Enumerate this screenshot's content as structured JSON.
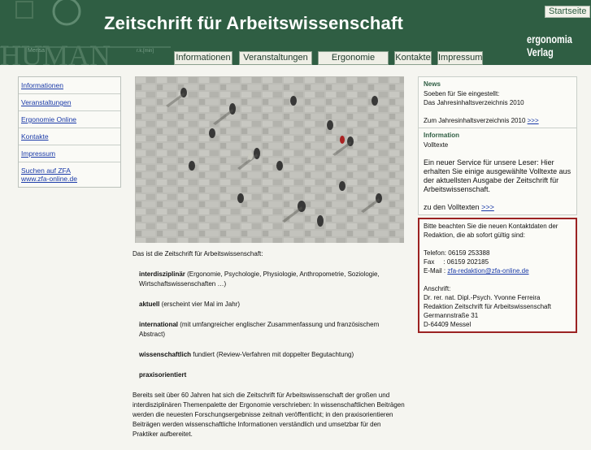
{
  "header": {
    "title": "Zeitschrift für Arbeitswissenschaft",
    "startseite": "Startseite",
    "brand_line1": "ergonomia",
    "brand_line2": "Verlag",
    "logo_text": "HUMAN",
    "logo_small1": "Mensa",
    "logo_small2": "r.k.[min]",
    "tabs": [
      "Informationen",
      "Veranstaltungen",
      "Ergonomie Online",
      "Kontakte",
      "Impressum"
    ],
    "bg_color": "#2f5e43"
  },
  "nav": {
    "items": [
      "Informationen",
      "Veranstaltungen",
      "Ergonomie Online",
      "Kontakte",
      "Impressum"
    ],
    "search_line1": "Suchen auf ZFA",
    "search_line2": "www.zfa-online.de"
  },
  "intro": {
    "lead": "Das ist die Zeitschrift für Arbeitswissenschaft:",
    "f1_bold": "interdisziplinär",
    "f1_text": " (Ergonomie, Psychologie, Physiologie, Anthropometrie, Soziologie, Wirtschaftswissenschaften …)",
    "f2_bold": "aktuell",
    "f2_text": " (erscheint vier Mal im Jahr)",
    "f3_bold": "international",
    "f3_text": " (mit umfangreicher englischer Zusammenfassung und französischem Abstract)",
    "f4_bold": "wissenschaftlich",
    "f4_text": " fundiert (Review-Verfahren mit doppelter Begutachtung)",
    "f5_bold": "praxisorientiert",
    "closing": "Bereits seit über 60 Jahren hat sich die Zeitschrift für Arbeitswissenschaft der großen und interdisziplinären Themenpalette der Ergonomie verschrieben: In wissenschaftlichen Beiträgen werden die neuesten Forschungsergebnisse zeitnah veröffentlicht; in den praxisorientieren Beiträgen werden wissenschaftliche Informationen verständlich und umsetzbar für den Praktiker aufbereitet."
  },
  "sidebar": {
    "news_head": "News",
    "news_l1": "Soeben für Sie eingestellt:",
    "news_l2": "Das Jahresinhaltsverzeichnis 2010",
    "news_link_text": "Zum Jahresinhaltsverzeichnis 2010 ",
    "news_link_arrow": ">>>",
    "info_head": "Information",
    "info_l1": "Volltexte",
    "info_body": "Ein neuer Service für unsere Leser: Hier erhalten Sie einige ausgewählte Volltexte aus der aktuellsten Ausgabe der Zeitschrift für Arbeitswissenschaft.",
    "info_link_text": "zu den Volltexten ",
    "info_link_arrow": ">>>"
  },
  "contact": {
    "intro": "Bitte beachten Sie die neuen Kontaktdaten der Redaktion, die ab sofort gültig sind:",
    "telefon": "Telefon: 06159 253388",
    "fax": "Fax     : 06159 202185",
    "email_label": "E-Mail : ",
    "email": "zfa-redaktion@zfa-online.de",
    "anschrift": "Anschrift:",
    "a1": "Dr. rer. nat. Dipl.-Psych. Yvonne Ferreira",
    "a2": "Redaktion Zeitschrift für Arbeitswissenschaft",
    "a3": "Germannstraße 31",
    "a4": "D-64409 Messel"
  }
}
